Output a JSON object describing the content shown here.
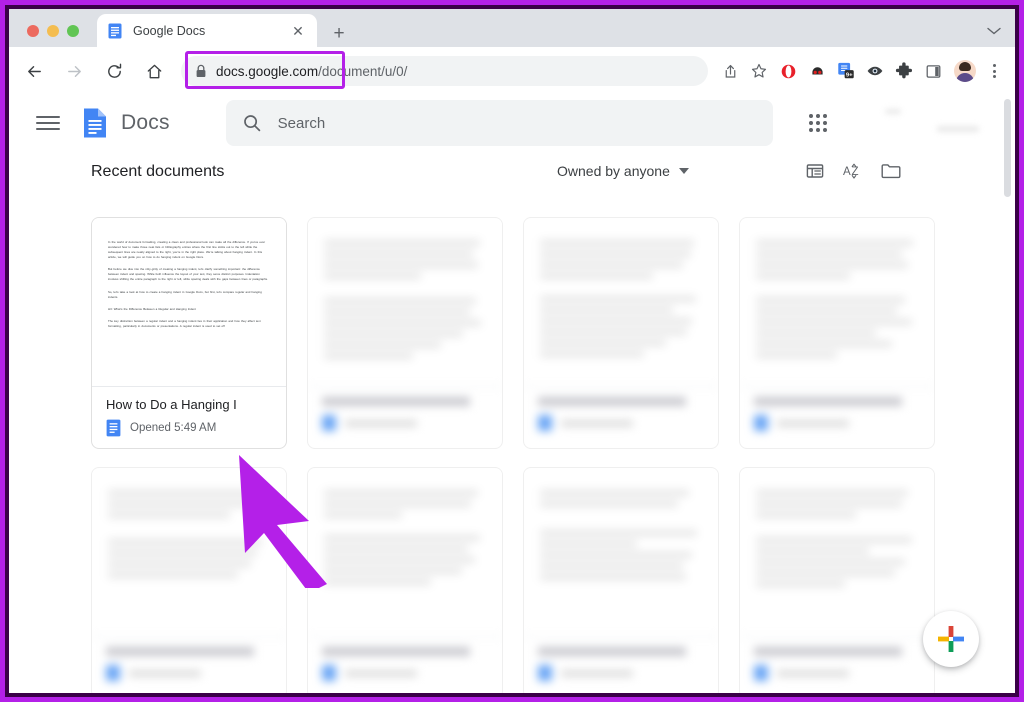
{
  "window": {
    "traffic_lights": [
      "close",
      "minimize",
      "maximize"
    ],
    "menu_label": "⌄"
  },
  "tab": {
    "title": "Google Docs",
    "favicon": "google-docs-icon",
    "close_label": "✕",
    "new_tab_label": "+"
  },
  "toolbar": {
    "back_label": "←",
    "forward_label": "→",
    "reload_label": "⟳",
    "home_label": "⌂",
    "url_prefix": "docs.google.com",
    "url_path": "/document/u/0/",
    "lock_icon": "lock-icon",
    "highlight_color": "#b420e8",
    "extensions": [
      {
        "name": "share-icon",
        "glyph": "share"
      },
      {
        "name": "bookmark-star-icon",
        "glyph": "star"
      },
      {
        "name": "opera-extension-icon",
        "glyph": "opera"
      },
      {
        "name": "adblock-extension-icon",
        "glyph": "adblock"
      },
      {
        "name": "grammar-extension-icon",
        "glyph": "grammar",
        "badge": "9+"
      },
      {
        "name": "eye-extension-icon",
        "glyph": "eye"
      },
      {
        "name": "puzzle-extensions-icon",
        "glyph": "puzzle"
      },
      {
        "name": "side-panel-icon",
        "glyph": "panel"
      }
    ],
    "profile_label": "profile-avatar",
    "menu_label": "chrome-menu"
  },
  "docs_header": {
    "menu_label": "main-menu",
    "logo_label": "google-docs-logo",
    "wordmark": "Docs",
    "search_placeholder": "Search",
    "apps_label": "google-apps-grid"
  },
  "section": {
    "title": "Recent documents",
    "owner_filter": "Owned by anyone",
    "view_list": "list-view-icon",
    "view_sort": "sort-az-icon",
    "view_folder": "file-picker-icon"
  },
  "documents": [
    {
      "name": "How to Do a Hanging I",
      "opened": "Opened 5:49 AM",
      "blurred": false,
      "preview": [
        "In the world of document formatting, creating a clean and professional look can make all the difference. If you've ever wondered how to make those neat lists or bibliography entries where the first line sticks out to the left while the subsequent lines are neatly aligned to the right, you're in the right place. We're talking about hanging indent. In this article, we will guide you on how to do hanging indent on Google Docs.",
        "But before we dive into the nitty-gritty of creating a hanging indent, let's clarify something important: the difference between indent and spacing. While both influence the layout of your text, they serve distinct purposes. Indentation involves shifting the entire paragraph to the right or left, while spacing deals with the gaps between lines or paragraphs.",
        "So, let's take a look at how to create a hanging indent in Google Docs, but first, let's compare regular and hanging indents.",
        "H3: What's the Difference Between a Regular and Hanging Indent",
        "The key distinction between a regular indent and a hanging indent lies in their application and how they affect text formatting, particularly in documents or presentations. A regular indent is used to set off"
      ]
    },
    {
      "name": "",
      "opened": "",
      "blurred": true
    },
    {
      "name": "",
      "opened": "",
      "blurred": true
    },
    {
      "name": "",
      "opened": "",
      "blurred": true
    },
    {
      "name": "",
      "opened": "",
      "blurred": true
    },
    {
      "name": "",
      "opened": "",
      "blurred": true
    },
    {
      "name": "",
      "opened": "",
      "blurred": true
    },
    {
      "name": "",
      "opened": "",
      "blurred": true
    }
  ],
  "fab": {
    "label": "new-document",
    "colors": [
      "#f4b400",
      "#db4437",
      "#4285f4",
      "#0f9d58"
    ]
  },
  "annotation": {
    "cursor_color": "#b420e8",
    "target": "How to Do a Hanging I"
  },
  "scrollbar": {
    "thumb_position": "top"
  }
}
